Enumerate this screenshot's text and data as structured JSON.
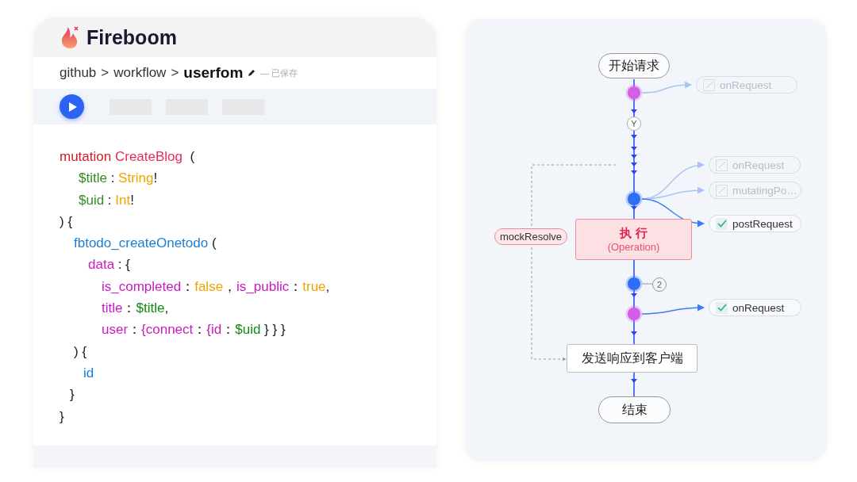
{
  "header": {
    "logo": "Fireboom"
  },
  "breadcrumb": {
    "path": [
      "github",
      ">",
      "workflow",
      ">"
    ],
    "current": "userfom",
    "status": "— 已保存"
  },
  "code": {
    "lines": [
      [
        {
          "text": "mutation ",
          "kind": "keyword"
        },
        {
          "text": "CreateBlog",
          "kind": "name"
        },
        {
          "text": "  (",
          "kind": "punct"
        }
      ],
      [
        {
          "text": "$title",
          "kind": "var"
        },
        {
          "text": " : ",
          "kind": "punct"
        },
        {
          "text": "String",
          "kind": "type"
        },
        {
          "text": "!",
          "kind": "punct"
        }
      ],
      [
        {
          "text": "$uid",
          "kind": "var"
        },
        {
          "text": " : ",
          "kind": "punct"
        },
        {
          "text": "Int",
          "kind": "type"
        },
        {
          "text": "!",
          "kind": "punct"
        }
      ],
      [
        {
          "text": ") {",
          "kind": "punct"
        }
      ],
      [
        {
          "text": "fbtodo_createOnetodo",
          "kind": "field"
        },
        {
          "text": " (",
          "kind": "punct"
        }
      ],
      [
        {
          "text": "data",
          "kind": "key"
        },
        {
          "text": " : {",
          "kind": "punct"
        }
      ],
      [
        {
          "text": "is_completed",
          "kind": "key"
        },
        {
          "text": "：",
          "kind": "punct"
        },
        {
          "text": "false",
          "kind": "literal"
        },
        {
          "text": "，",
          "kind": "punct"
        },
        {
          "text": "is_public",
          "kind": "key"
        },
        {
          "text": "：",
          "kind": "punct"
        },
        {
          "text": "true",
          "kind": "literal"
        },
        {
          "text": ",",
          "kind": "punct"
        }
      ],
      [
        {
          "text": "title",
          "kind": "key"
        },
        {
          "text": "：",
          "kind": "punct"
        },
        {
          "text": "$title",
          "kind": "value"
        },
        {
          "text": ",",
          "kind": "punct"
        }
      ],
      [
        {
          "text": "user",
          "kind": "key"
        },
        {
          "text": "：",
          "kind": "punct"
        },
        {
          "text": "{connect",
          "kind": "key"
        },
        {
          "text": "：",
          "kind": "punct"
        },
        {
          "text": "{id",
          "kind": "key"
        },
        {
          "text": "：",
          "kind": "punct"
        },
        {
          "text": "$uid",
          "kind": "value"
        },
        {
          "text": " } } }",
          "kind": "punct"
        }
      ],
      [
        {
          "text": ") {",
          "kind": "punct"
        }
      ],
      [
        {
          "text": "id",
          "kind": "field"
        }
      ],
      [
        {
          "text": "}",
          "kind": "punct"
        }
      ],
      [
        {
          "text": "}",
          "kind": "punct"
        }
      ]
    ]
  },
  "flow": {
    "start": "开始请求",
    "branch": "Y",
    "dots": [
      {
        "color": "#d45ee8"
      },
      {
        "color": "#2f6ef5"
      },
      {
        "color": "#2f6ef5"
      },
      {
        "color": "#d45ee8"
      }
    ],
    "hooks": [
      {
        "label": "onRequest",
        "checked": false
      },
      {
        "label": "onRequest",
        "checked": false
      },
      {
        "label": "mutatingPo…",
        "checked": false
      },
      {
        "label": "postRequest",
        "checked": true
      },
      {
        "label": "onRequest",
        "checked": true
      }
    ],
    "operation": {
      "title": "执 行",
      "subtitle": "(Operation)"
    },
    "mock": "mockResolve",
    "count": "2",
    "send": "发送响应到客户端",
    "end": "结束"
  }
}
